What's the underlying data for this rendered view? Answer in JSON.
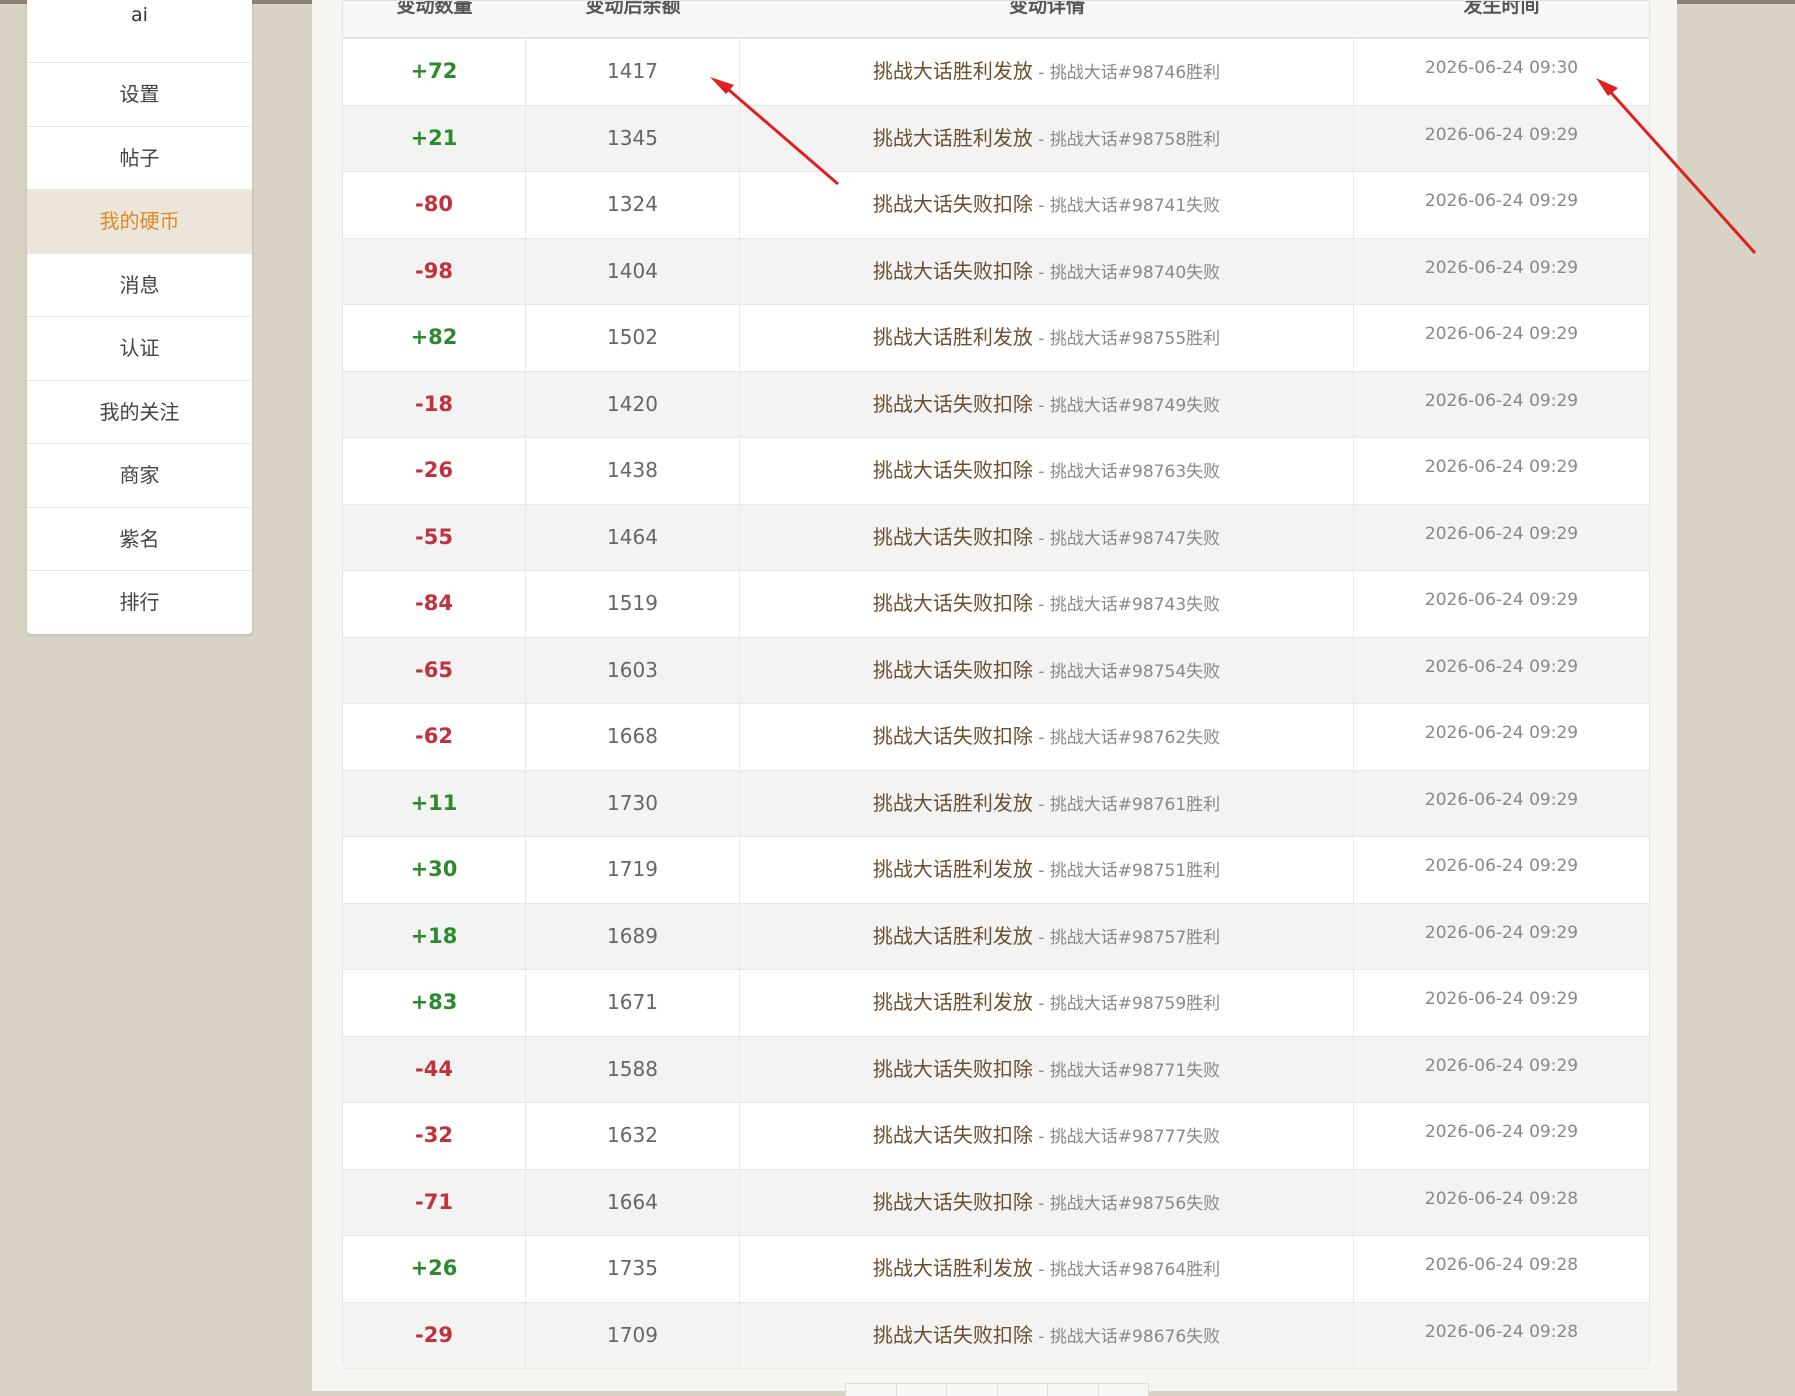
{
  "sidebar": {
    "user_name": "ai",
    "items": [
      {
        "label": "设置",
        "active": false
      },
      {
        "label": "帖子",
        "active": false
      },
      {
        "label": "我的硬币",
        "active": true
      },
      {
        "label": "消息",
        "active": false
      },
      {
        "label": "认证",
        "active": false
      },
      {
        "label": "我的关注",
        "active": false
      },
      {
        "label": "商家",
        "active": false
      },
      {
        "label": "紫名",
        "active": false
      },
      {
        "label": "排行",
        "active": false
      }
    ]
  },
  "table": {
    "headers": [
      "变动数量",
      "变动后余额",
      "变动详情",
      "发生时间"
    ],
    "rows": [
      {
        "change": "+72",
        "balance": "1417",
        "title": "挑战大话胜利发放",
        "detail": "挑战大话#98746胜利",
        "time": "2026-06-24 09:30"
      },
      {
        "change": "+21",
        "balance": "1345",
        "title": "挑战大话胜利发放",
        "detail": "挑战大话#98758胜利",
        "time": "2026-06-24 09:29"
      },
      {
        "change": "-80",
        "balance": "1324",
        "title": "挑战大话失败扣除",
        "detail": "挑战大话#98741失败",
        "time": "2026-06-24 09:29"
      },
      {
        "change": "-98",
        "balance": "1404",
        "title": "挑战大话失败扣除",
        "detail": "挑战大话#98740失败",
        "time": "2026-06-24 09:29"
      },
      {
        "change": "+82",
        "balance": "1502",
        "title": "挑战大话胜利发放",
        "detail": "挑战大话#98755胜利",
        "time": "2026-06-24 09:29"
      },
      {
        "change": "-18",
        "balance": "1420",
        "title": "挑战大话失败扣除",
        "detail": "挑战大话#98749失败",
        "time": "2026-06-24 09:29"
      },
      {
        "change": "-26",
        "balance": "1438",
        "title": "挑战大话失败扣除",
        "detail": "挑战大话#98763失败",
        "time": "2026-06-24 09:29"
      },
      {
        "change": "-55",
        "balance": "1464",
        "title": "挑战大话失败扣除",
        "detail": "挑战大话#98747失败",
        "time": "2026-06-24 09:29"
      },
      {
        "change": "-84",
        "balance": "1519",
        "title": "挑战大话失败扣除",
        "detail": "挑战大话#98743失败",
        "time": "2026-06-24 09:29"
      },
      {
        "change": "-65",
        "balance": "1603",
        "title": "挑战大话失败扣除",
        "detail": "挑战大话#98754失败",
        "time": "2026-06-24 09:29"
      },
      {
        "change": "-62",
        "balance": "1668",
        "title": "挑战大话失败扣除",
        "detail": "挑战大话#98762失败",
        "time": "2026-06-24 09:29"
      },
      {
        "change": "+11",
        "balance": "1730",
        "title": "挑战大话胜利发放",
        "detail": "挑战大话#98761胜利",
        "time": "2026-06-24 09:29"
      },
      {
        "change": "+30",
        "balance": "1719",
        "title": "挑战大话胜利发放",
        "detail": "挑战大话#98751胜利",
        "time": "2026-06-24 09:29"
      },
      {
        "change": "+18",
        "balance": "1689",
        "title": "挑战大话胜利发放",
        "detail": "挑战大话#98757胜利",
        "time": "2026-06-24 09:29"
      },
      {
        "change": "+83",
        "balance": "1671",
        "title": "挑战大话胜利发放",
        "detail": "挑战大话#98759胜利",
        "time": "2026-06-24 09:29"
      },
      {
        "change": "-44",
        "balance": "1588",
        "title": "挑战大话失败扣除",
        "detail": "挑战大话#98771失败",
        "time": "2026-06-24 09:29"
      },
      {
        "change": "-32",
        "balance": "1632",
        "title": "挑战大话失败扣除",
        "detail": "挑战大话#98777失败",
        "time": "2026-06-24 09:29"
      },
      {
        "change": "-71",
        "balance": "1664",
        "title": "挑战大话失败扣除",
        "detail": "挑战大话#98756失败",
        "time": "2026-06-24 09:28"
      },
      {
        "change": "+26",
        "balance": "1735",
        "title": "挑战大话胜利发放",
        "detail": "挑战大话#98764胜利",
        "time": "2026-06-24 09:28"
      },
      {
        "change": "-29",
        "balance": "1709",
        "title": "挑战大话失败扣除",
        "detail": "挑战大话#98676失败",
        "time": "2026-06-24 09:28"
      }
    ]
  },
  "colors": {
    "positive": "#2c8a2c",
    "negative": "#c0323c",
    "active_menu": "#e0892a",
    "annotation_arrow": "#e02020"
  }
}
